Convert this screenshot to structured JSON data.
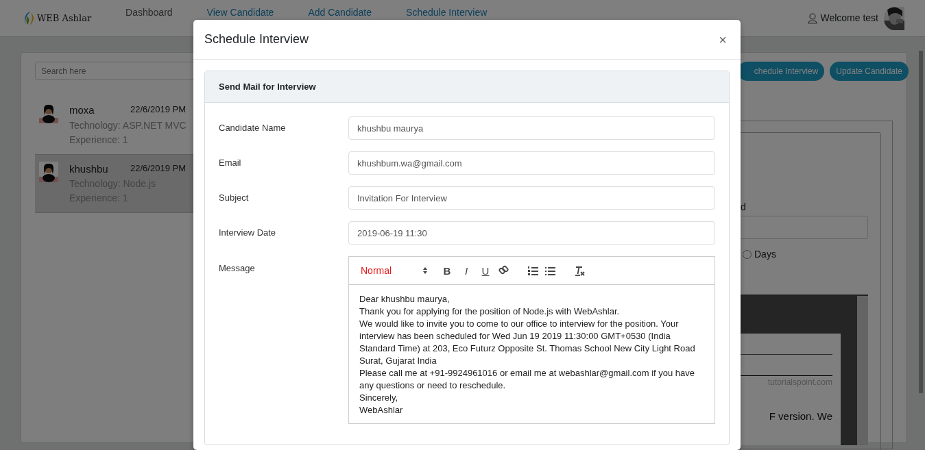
{
  "navbar": {
    "brand": "WEB Ashlar",
    "links": [
      {
        "label": "Dashboard",
        "selected": false
      },
      {
        "label": "View Candidate",
        "selected": true
      },
      {
        "label": "Add Candidate",
        "selected": true
      },
      {
        "label": "Schedule Interview",
        "selected": true
      }
    ],
    "welcome": "Welcome test"
  },
  "search": {
    "placeholder": "Search here"
  },
  "candidates": [
    {
      "name": "moxa",
      "date": "22/6/2019 PM",
      "technology": "Technology: ASP.NET MVC",
      "experience": "Experience: 1",
      "selected": false
    },
    {
      "name": "khushbu",
      "date": "22/6/2019 PM",
      "technology": "Technology: Node.js",
      "experience": "Experience: 1",
      "selected": true
    }
  ],
  "actions": [
    "chedule Interview",
    "Update Candidate"
  ],
  "detail": {
    "label_fragment": "d",
    "radio": {
      "label": "Days",
      "checked": false
    },
    "viewer": {
      "site": "tutorialspoint.com",
      "text": "F version. We"
    }
  },
  "modal": {
    "title": "Schedule Interview",
    "close": "×",
    "card_title": "Send Mail for Interview",
    "fields": [
      {
        "label": "Candidate Name",
        "value": "khushbu maurya"
      },
      {
        "label": "Email",
        "value": "khushbum.wa@gmail.com"
      },
      {
        "label": "Subject",
        "value": "Invitation For Interview"
      },
      {
        "label": "Interview Date",
        "value": "2019-06-19 11:30"
      }
    ],
    "message": {
      "label": "Message",
      "format": "Normal",
      "toolbar": [
        {
          "kind": "bold",
          "label": "B"
        },
        {
          "kind": "italic",
          "label": "I"
        },
        {
          "kind": "underline",
          "label": "U"
        },
        {
          "kind": "link"
        },
        {
          "kind": "ordered-list"
        },
        {
          "kind": "bullet-list"
        },
        {
          "kind": "clean"
        }
      ],
      "lines": [
        "Dear khushbu maurya,",
        "Thank you for applying for the position of Node.js with WebAshlar.",
        "We would like to invite you to come to our office to interview for the position. Your interview has been scheduled for Wed Jun 19 2019 11:30:00 GMT+0530 (India Standard Time) at 203, Eco Futurz Opposite St. Thomas School New City Light Road Surat, Gujarat India",
        "Please call me at +91-9924961016 or email me at webashlar@gmail.com if you have any questions or need to reschedule.",
        "Sincerely,",
        "WebAshlar"
      ]
    }
  }
}
